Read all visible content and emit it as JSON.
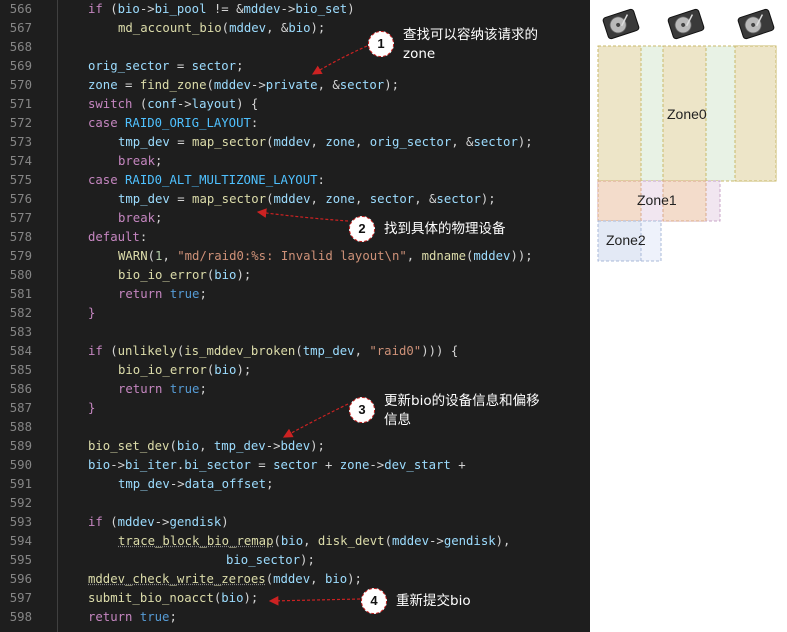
{
  "editor": {
    "lines": [
      {
        "n": "566",
        "t": "if (bio->bi_pool != &mddev->bio_set)"
      },
      {
        "n": "567",
        "t": "md_account_bio(mddev, &bio);"
      },
      {
        "n": "568",
        "t": ""
      },
      {
        "n": "569",
        "t": "orig_sector = sector;"
      },
      {
        "n": "570",
        "t": "zone = find_zone(mddev->private, &sector);"
      },
      {
        "n": "571",
        "t": "switch (conf->layout) {"
      },
      {
        "n": "572",
        "t": "case RAID0_ORIG_LAYOUT:"
      },
      {
        "n": "573",
        "t": "tmp_dev = map_sector(mddev, zone, orig_sector, &sector);"
      },
      {
        "n": "574",
        "t": "break;"
      },
      {
        "n": "575",
        "t": "case RAID0_ALT_MULTIZONE_LAYOUT:"
      },
      {
        "n": "576",
        "t": "tmp_dev = map_sector(mddev, zone, sector, &sector);"
      },
      {
        "n": "577",
        "t": "break;"
      },
      {
        "n": "578",
        "t": "default:"
      },
      {
        "n": "579",
        "t": "WARN(1, \"md/raid0:%s: Invalid layout\\n\", mdname(mddev));"
      },
      {
        "n": "580",
        "t": "bio_io_error(bio);"
      },
      {
        "n": "581",
        "t": "return true;"
      },
      {
        "n": "582",
        "t": "}"
      },
      {
        "n": "583",
        "t": ""
      },
      {
        "n": "584",
        "t": "if (unlikely(is_mddev_broken(tmp_dev, \"raid0\"))) {"
      },
      {
        "n": "585",
        "t": "bio_io_error(bio);"
      },
      {
        "n": "586",
        "t": "return true;"
      },
      {
        "n": "587",
        "t": "}"
      },
      {
        "n": "588",
        "t": ""
      },
      {
        "n": "589",
        "t": "bio_set_dev(bio, tmp_dev->bdev);"
      },
      {
        "n": "590",
        "t": "bio->bi_iter.bi_sector = sector + zone->dev_start +"
      },
      {
        "n": "591",
        "t": "tmp_dev->data_offset;"
      },
      {
        "n": "592",
        "t": ""
      },
      {
        "n": "593",
        "t": "if (mddev->gendisk)"
      },
      {
        "n": "594",
        "t": "trace_block_bio_remap(bio, disk_devt(mddev->gendisk),"
      },
      {
        "n": "595",
        "t": "bio_sector);"
      },
      {
        "n": "596",
        "t": "mddev_check_write_zeroes(mddev, bio);"
      },
      {
        "n": "597",
        "t": "submit_bio_noacct(bio);"
      },
      {
        "n": "598",
        "t": "return true;"
      }
    ]
  },
  "annotations": [
    {
      "num": "1",
      "text_line1": "查找可以容纳该请求的",
      "text_line2": "zone"
    },
    {
      "num": "2",
      "text_line1": "找到具体的物理设备",
      "text_line2": ""
    },
    {
      "num": "3",
      "text_line1": "更新bio的设备信息和偏移",
      "text_line2": "信息"
    },
    {
      "num": "4",
      "text_line1": "重新提交bio",
      "text_line2": ""
    }
  ],
  "diagram": {
    "disks": [
      "hard-disk-icon",
      "hard-disk-icon",
      "hard-disk-icon"
    ],
    "zones": [
      "Zone0",
      "Zone1",
      "Zone2"
    ],
    "colors": {
      "zone0": "#ece4c7",
      "zone0_bg": "#e7f2e6",
      "zone1": "#f2dcc9",
      "zone2": "#e3e9f5",
      "arrow": "#cc2222"
    }
  }
}
